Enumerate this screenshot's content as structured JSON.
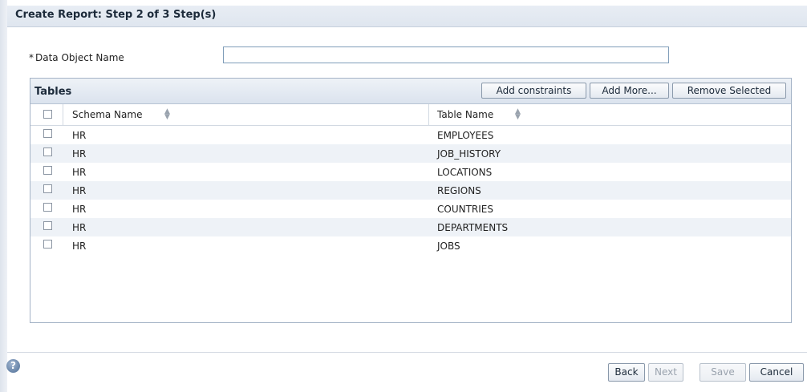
{
  "dialog": {
    "title": "Create Report: Step 2 of 3 Step(s)"
  },
  "form": {
    "required_marker": "*",
    "data_object_label": "Data Object Name",
    "data_object_value": "",
    "data_object_placeholder": ""
  },
  "tables_panel": {
    "title": "Tables",
    "buttons": {
      "add_constraints": "Add constraints",
      "add_more": "Add More...",
      "remove_selected": "Remove Selected"
    },
    "columns": [
      "Schema Name",
      "Table Name"
    ],
    "rows": [
      {
        "schema": "HR",
        "table": "EMPLOYEES"
      },
      {
        "schema": "HR",
        "table": "JOB_HISTORY"
      },
      {
        "schema": "HR",
        "table": "LOCATIONS"
      },
      {
        "schema": "HR",
        "table": "REGIONS"
      },
      {
        "schema": "HR",
        "table": "COUNTRIES"
      },
      {
        "schema": "HR",
        "table": "DEPARTMENTS"
      },
      {
        "schema": "HR",
        "table": "JOBS"
      }
    ]
  },
  "footer": {
    "help_icon": "question-circle",
    "help_glyph": "?",
    "back": "Back",
    "next": "Next",
    "save": "Save",
    "cancel": "Cancel"
  },
  "colors": {
    "title_bar": "#dfe6ef",
    "row_alt": "#eef2f7",
    "border": "#a4b3c6"
  }
}
